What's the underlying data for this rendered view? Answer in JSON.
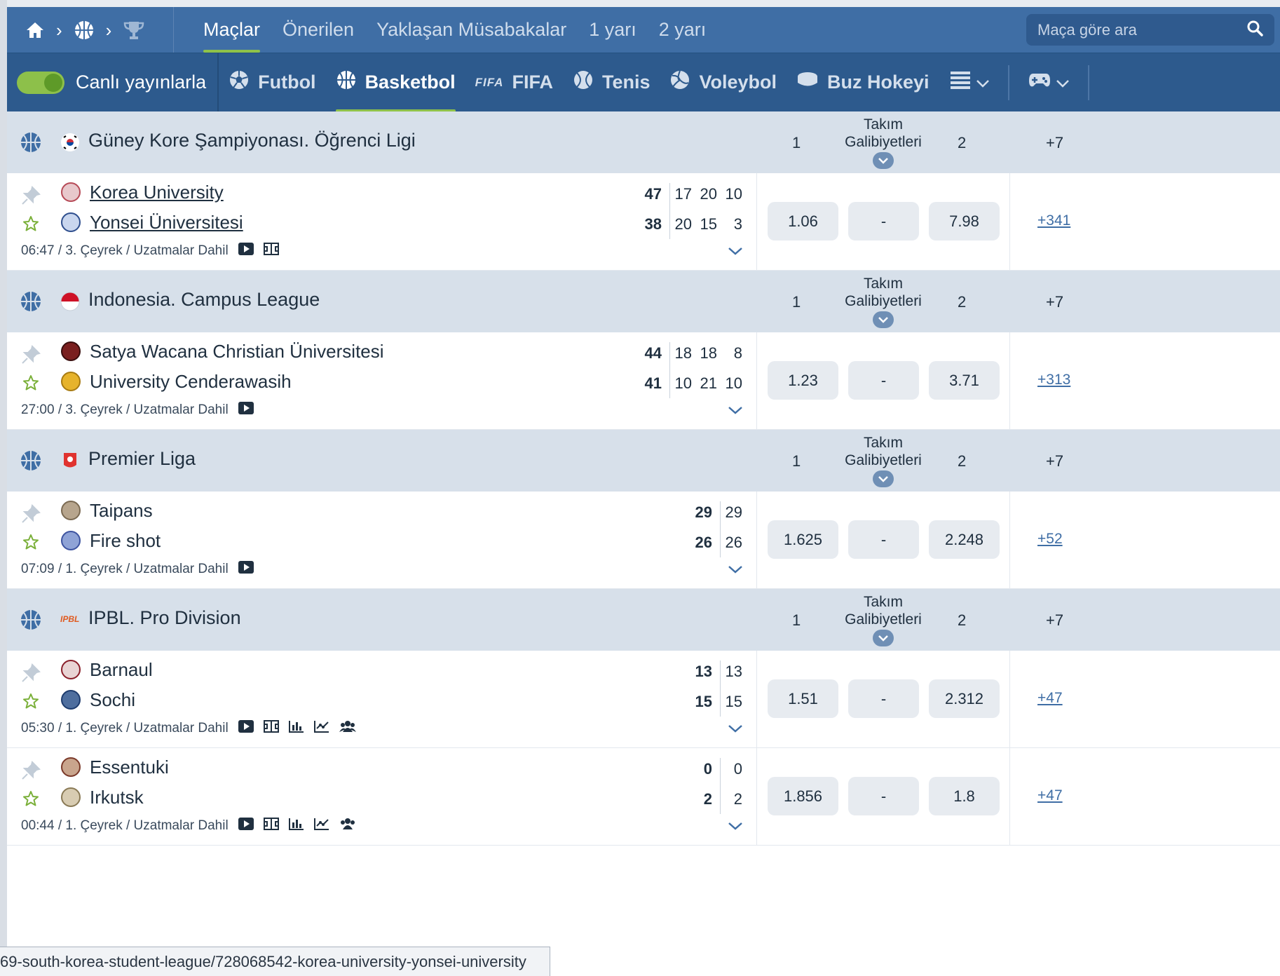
{
  "breadcrumbs": [
    "home-icon",
    "basketball-icon",
    "trophy-icon"
  ],
  "top_tabs": [
    {
      "label": "Maçlar",
      "active": true
    },
    {
      "label": "Önerilen",
      "active": false
    },
    {
      "label": "Yaklaşan Müsabakalar",
      "active": false
    },
    {
      "label": "1 yarı",
      "active": false
    },
    {
      "label": "2 yarı",
      "active": false
    }
  ],
  "search": {
    "placeholder": "Maça göre ara"
  },
  "live_toggle": {
    "label": "Canlı yayınlarla",
    "on": true
  },
  "sports": [
    {
      "label": "Futbol",
      "icon": "soccer-ball-icon",
      "active": false
    },
    {
      "label": "Basketbol",
      "icon": "basketball-icon",
      "active": true
    },
    {
      "label": "FIFA",
      "icon": "fifa-icon",
      "active": false
    },
    {
      "label": "Tenis",
      "icon": "tennis-ball-icon",
      "active": false
    },
    {
      "label": "Voleybol",
      "icon": "volleyball-icon",
      "active": false
    },
    {
      "label": "Buz Hokeyi",
      "icon": "hockey-puck-icon",
      "active": false
    }
  ],
  "columns": {
    "c1": "1",
    "tg_line1": "Takım",
    "tg_line2": "Galibiyetleri",
    "c2": "2",
    "plus": "+7"
  },
  "leagues": [
    {
      "name": "Güney Kore Şampiyonası. Öğrenci Ligi",
      "matches": [
        {
          "team1": "Korea University",
          "team2": "Yonsei Üniversitesi",
          "link": true,
          "score1": {
            "total": "47",
            "periods": [
              "17",
              "20",
              "10"
            ]
          },
          "score2": {
            "total": "38",
            "periods": [
              "20",
              "15",
              "3"
            ]
          },
          "meta": "06:47 / 3. Çeyrek / Uzatmalar Dahil",
          "odds": [
            "1.06",
            "-",
            "7.98"
          ],
          "more": "+341"
        }
      ]
    },
    {
      "name": "Indonesia. Campus League",
      "matches": [
        {
          "team1": "Satya Wacana Christian Üniversitesi",
          "team2": "University Cenderawasih",
          "link": false,
          "score1": {
            "total": "44",
            "periods": [
              "18",
              "18",
              "8"
            ]
          },
          "score2": {
            "total": "41",
            "periods": [
              "10",
              "21",
              "10"
            ]
          },
          "meta": "27:00 / 3. Çeyrek / Uzatmalar Dahil",
          "odds": [
            "1.23",
            "-",
            "3.71"
          ],
          "more": "+313"
        }
      ]
    },
    {
      "name": "Premier Liga",
      "matches": [
        {
          "team1": "Taipans",
          "team2": "Fire shot",
          "link": false,
          "score1": {
            "total": "29",
            "periods": [
              "29"
            ]
          },
          "score2": {
            "total": "26",
            "periods": [
              "26"
            ]
          },
          "meta": "07:09 / 1. Çeyrek / Uzatmalar Dahil",
          "odds": [
            "1.625",
            "-",
            "2.248"
          ],
          "more": "+52"
        }
      ]
    },
    {
      "name": "IPBL. Pro Division",
      "flag_text": "IPBL",
      "matches": [
        {
          "team1": "Barnaul",
          "team2": "Sochi",
          "link": false,
          "score1": {
            "total": "13",
            "periods": [
              "13"
            ]
          },
          "score2": {
            "total": "15",
            "periods": [
              "15"
            ]
          },
          "meta": "05:30 / 1. Çeyrek / Uzatmalar Dahil",
          "odds": [
            "1.51",
            "-",
            "2.312"
          ],
          "more": "+47"
        },
        {
          "team1": "Essentuki",
          "team2": "Irkutsk",
          "link": false,
          "score1": {
            "total": "0",
            "periods": [
              "0"
            ]
          },
          "score2": {
            "total": "2",
            "periods": [
              "2"
            ]
          },
          "meta": "00:44 / 1. Çeyrek / Uzatmalar Dahil",
          "odds": [
            "1.856",
            "-",
            "1.8"
          ],
          "more": "+47"
        }
      ]
    }
  ],
  "status_url": "69-south-korea-student-league/728068542-korea-university-yonsei-university",
  "colors": {
    "nav": "#3f6ea5",
    "sportbar": "#2d5a8d",
    "accent": "#8fc24a",
    "league_bg": "#d7e0ea",
    "odd_bg": "#e7ebf0"
  }
}
